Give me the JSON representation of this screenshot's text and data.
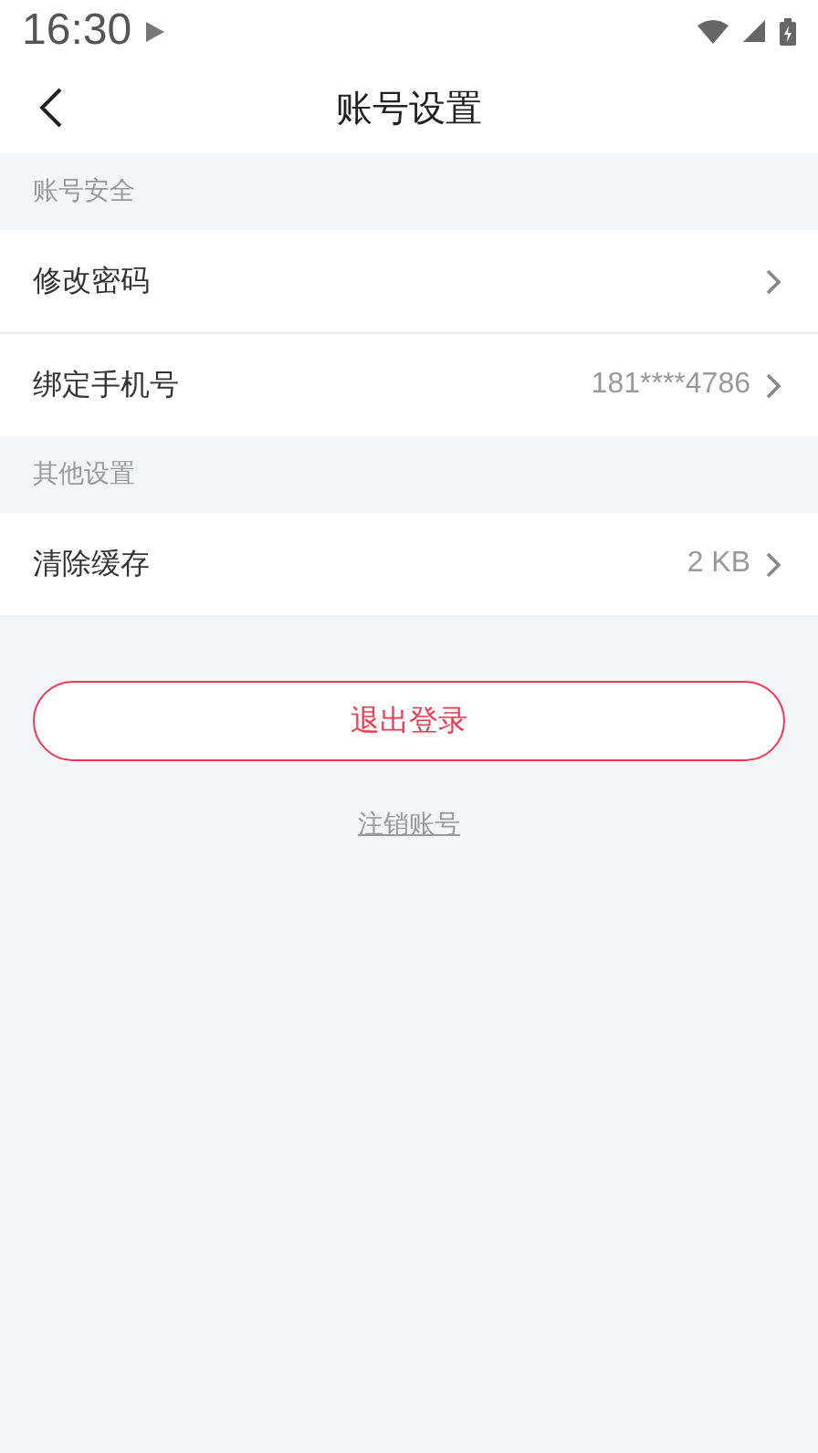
{
  "status_bar": {
    "time": "16:30"
  },
  "header": {
    "title": "账号设置"
  },
  "sections": [
    {
      "title": "账号安全",
      "rows": [
        {
          "label": "修改密码"
        },
        {
          "label": "绑定手机号",
          "value": "181****4786"
        }
      ]
    },
    {
      "title": "其他设置",
      "rows": [
        {
          "label": "清除缓存",
          "value": "2 KB"
        }
      ]
    }
  ],
  "logout_button": "退出登录",
  "delete_account_link": "注销账号"
}
